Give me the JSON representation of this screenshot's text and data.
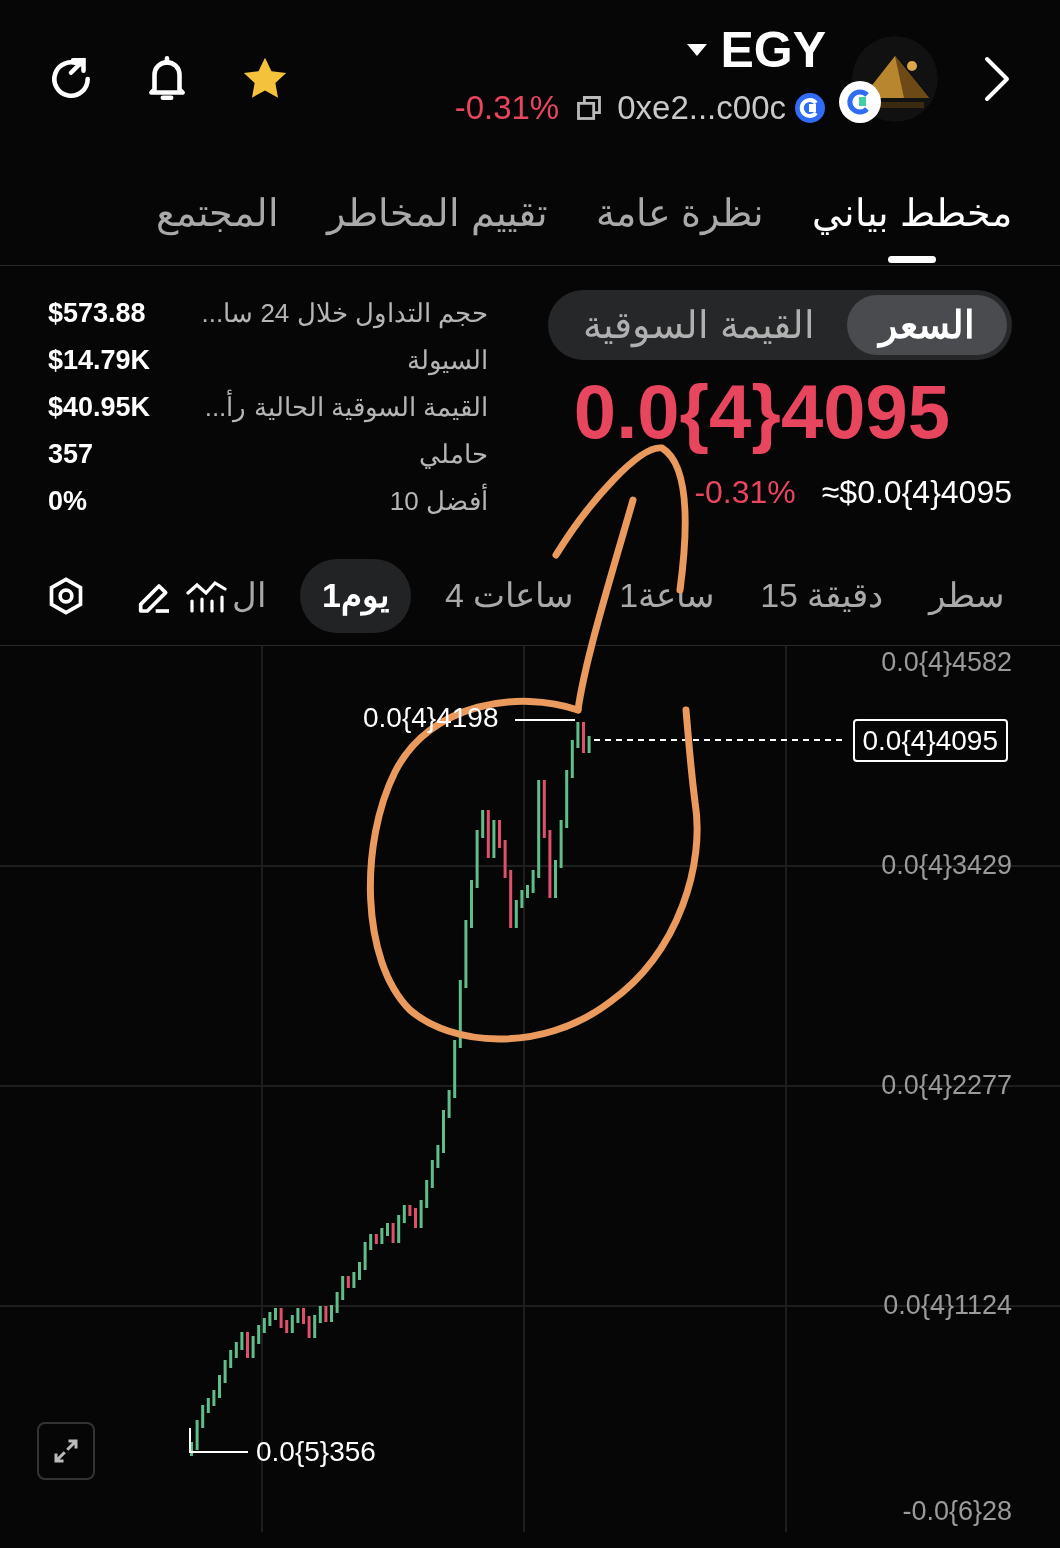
{
  "header": {
    "favorite": true,
    "title": "EGY",
    "change": "-0.31%",
    "address": "0xe2...c00c"
  },
  "tabs": [
    {
      "label": "مخطط بياني",
      "selected": true
    },
    {
      "label": "نظرة عامة",
      "selected": false
    },
    {
      "label": "تقييم المخاطر",
      "selected": false
    },
    {
      "label": "المجتمع",
      "selected": false
    }
  ],
  "stats": [
    {
      "label": "حجم التداول خلال 24 سا...",
      "value": "$573.88"
    },
    {
      "label": "السيولة",
      "value": "$14.79K"
    },
    {
      "label": "القيمة السوقية الحالية رأ...",
      "value": "$40.95K"
    },
    {
      "label": "حاملي",
      "value": "357"
    },
    {
      "label": "أفضل 10",
      "value": "0%"
    }
  ],
  "price_toggle": [
    {
      "label": "السعر",
      "selected": true
    },
    {
      "label": "القيمة السوقية",
      "selected": false
    }
  ],
  "price": "0.0{4}4095",
  "price_change": "-0.31%",
  "price_usd": "≈$0.0{4}4095",
  "intervals": [
    {
      "label": "سطر",
      "selected": false,
      "kind": "text"
    },
    {
      "label": "15 دقيقة",
      "selected": false,
      "kind": "text"
    },
    {
      "label": "1ساعة",
      "selected": false,
      "kind": "text"
    },
    {
      "label": "4 ساعات",
      "selected": false,
      "kind": "text"
    },
    {
      "label": "1يوم",
      "selected": true,
      "kind": "text"
    },
    {
      "label": "ال",
      "selected": false,
      "kind": "indicator"
    }
  ],
  "chart": {
    "y_axis": [
      "0.0{4}4582",
      "0.0{4}3429",
      "0.0{4}2277",
      "0.0{4}1124",
      "-0.0{6}28"
    ],
    "current_price": "0.0{4}4095",
    "high_label": "0.0{4}4198",
    "low_label": "0.0{5}356"
  }
}
